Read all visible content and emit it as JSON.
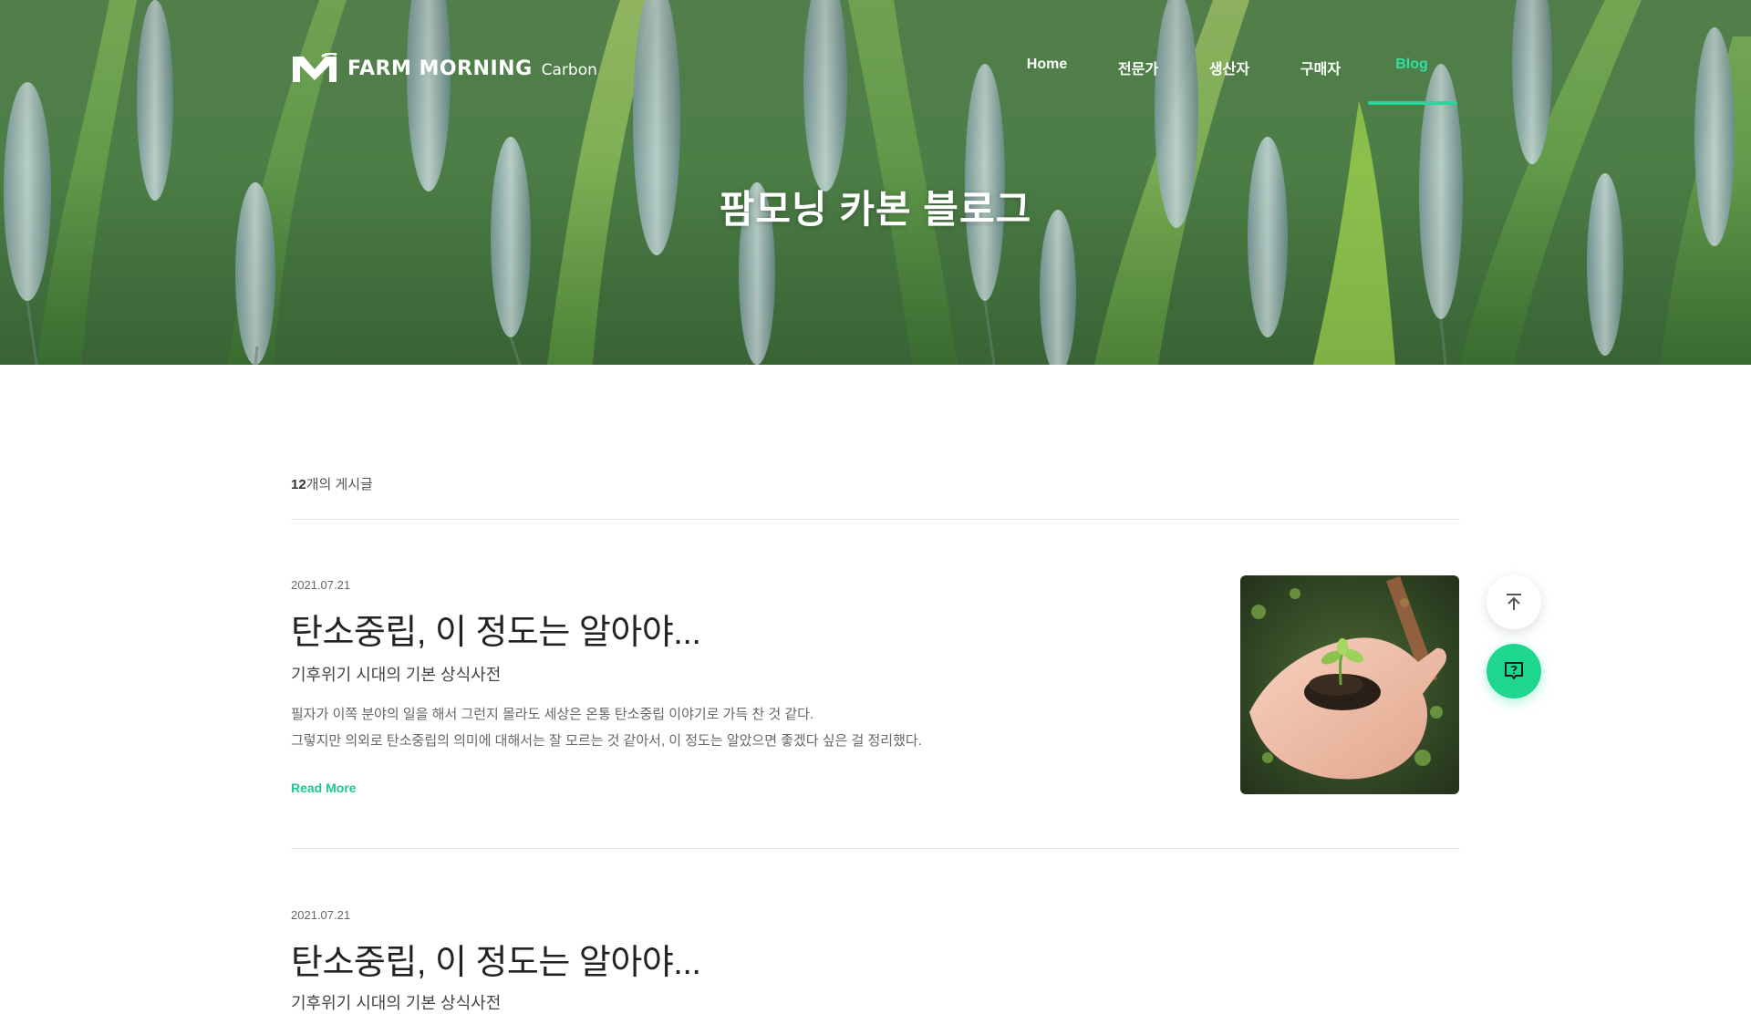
{
  "brand": {
    "name": "FARM MORNING",
    "sub": "Carbon"
  },
  "nav": {
    "items": [
      {
        "label": "Home",
        "active": false
      },
      {
        "label": "전문가",
        "active": false
      },
      {
        "label": "생산자",
        "active": false
      },
      {
        "label": "구매자",
        "active": false
      },
      {
        "label": "Blog",
        "active": true
      }
    ]
  },
  "hero": {
    "title": "팜모닝 카본 블로그"
  },
  "list": {
    "count": "12",
    "count_suffix": "개의 게시글"
  },
  "posts": [
    {
      "date": "2021.07.21",
      "title": "탄소중립, 이 정도는 알아야...",
      "subtitle": "기후위기 시대의 기본 상식사전",
      "excerpt_line1": "필자가 이쪽 분야의 일을 해서 그런지 몰라도 세상은 온통 탄소중립 이야기로 가득 찬 것 같다.",
      "excerpt_line2": "그렇지만 의외로 탄소중립의 의미에 대해서는 잘 모르는 것 같아서, 이 정도는 알았으면 좋겠다 싶은 걸 정리했다.",
      "read_more": "Read More"
    },
    {
      "date": "2021.07.21",
      "title": "탄소중립, 이 정도는 알아야...",
      "subtitle": "기후위기 시대의 기본 상식사전"
    }
  ],
  "fab": {
    "top_icon": "arrow-up-to-top-icon",
    "help_icon": "help-chat-icon"
  },
  "colors": {
    "accent": "#1ec98b",
    "accent_nav": "#2fe0a0",
    "text_dark": "#222222"
  }
}
